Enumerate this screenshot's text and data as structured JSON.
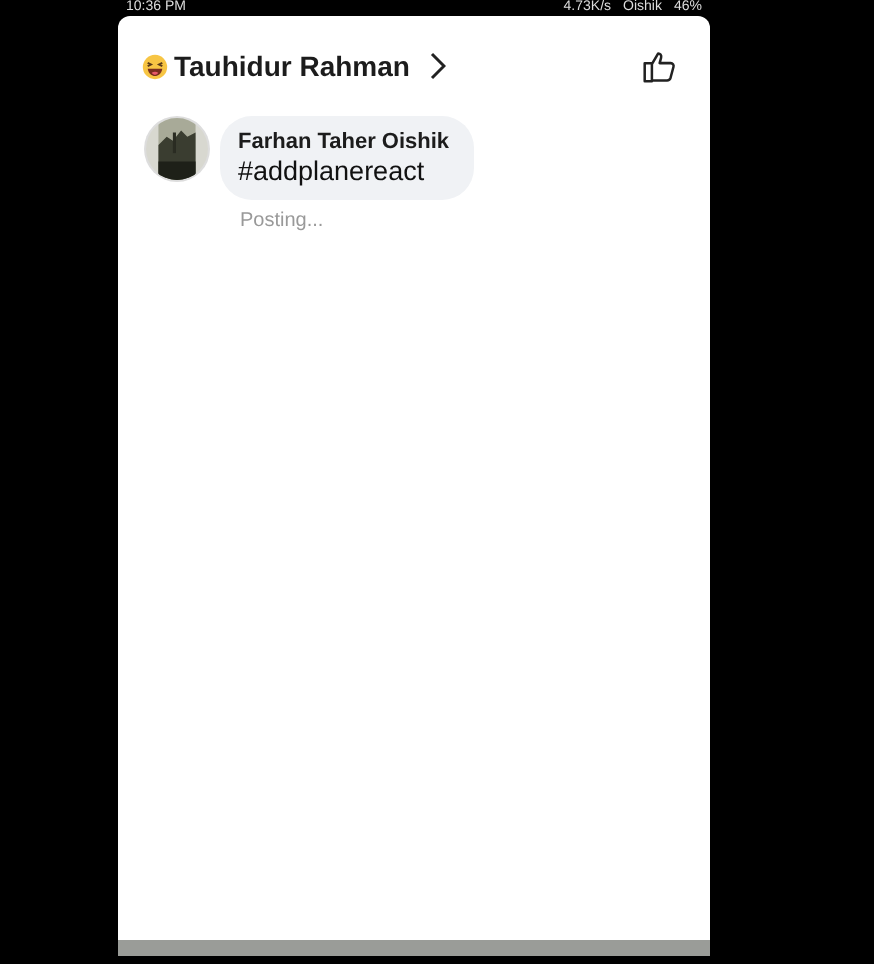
{
  "status_bar": {
    "time": "10:36 PM",
    "speed": "4.73K/s",
    "carrier": "Oishik",
    "battery": "46%"
  },
  "header": {
    "title": "Tauhidur Rahman"
  },
  "comments": [
    {
      "author": "Farhan Taher Oishik",
      "text": "#addplanereact",
      "status": "Posting..."
    }
  ]
}
